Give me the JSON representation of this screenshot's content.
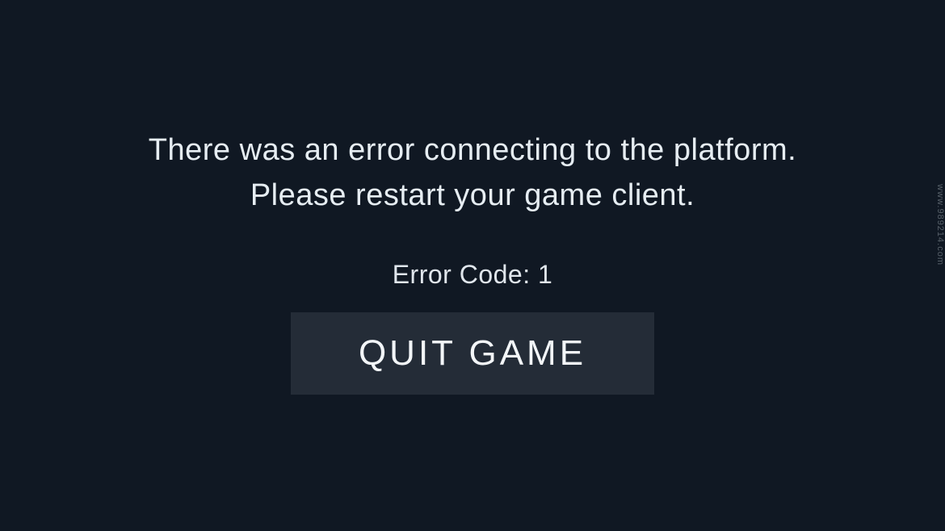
{
  "dialog": {
    "message": "There was an error connecting to the platform. Please restart your game client.",
    "error_code_label": "Error Code: 1",
    "quit_button_label": "QUIT GAME"
  },
  "watermark": "www.989214.com"
}
